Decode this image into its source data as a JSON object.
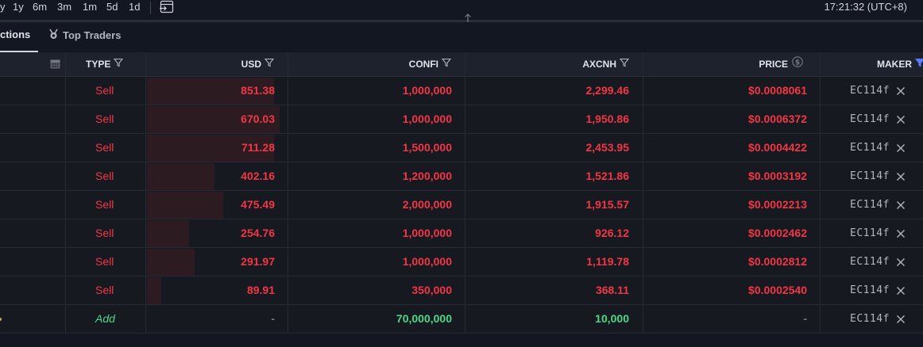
{
  "toolbar": {
    "timeframes": [
      "y",
      "1y",
      "6m",
      "3m",
      "1m",
      "5d",
      "1d"
    ],
    "clock": "17:21:32 (UTC+8)",
    "icons": [
      "goto-date-icon",
      "resize-handle-icon"
    ]
  },
  "tabs": {
    "active_label": "ctions",
    "second_label": "Top Traders",
    "second_icon": "medal-icon"
  },
  "table": {
    "headers": {
      "type": "TYPE",
      "usd": "USD",
      "confi": "CONFI",
      "axcnh": "AXCNH",
      "price": "PRICE",
      "maker": "MAKER"
    },
    "header_icons": [
      "calendar-icon",
      "filter-icon",
      "dollar-circle-icon",
      "filter-active-icon"
    ],
    "rows": [
      {
        "type": "Sell",
        "usd": "851.38",
        "confi": "1,000,000",
        "axcnh": "2,299.46",
        "price": "$0.0008061",
        "maker": "EC114f",
        "bar": 0.45
      },
      {
        "type": "Sell",
        "usd": "670.03",
        "confi": "1,000,000",
        "axcnh": "1,950.86",
        "price": "$0.0006372",
        "maker": "EC114f",
        "bar": 0.47
      },
      {
        "type": "Sell",
        "usd": "711.28",
        "confi": "1,500,000",
        "axcnh": "2,453.95",
        "price": "$0.0004422",
        "maker": "EC114f",
        "bar": 0.45
      },
      {
        "type": "Sell",
        "usd": "402.16",
        "confi": "1,200,000",
        "axcnh": "1,521.86",
        "price": "$0.0003192",
        "maker": "EC114f",
        "bar": 0.24
      },
      {
        "type": "Sell",
        "usd": "475.49",
        "confi": "2,000,000",
        "axcnh": "1,915.57",
        "price": "$0.0002213",
        "maker": "EC114f",
        "bar": 0.27
      },
      {
        "type": "Sell",
        "usd": "254.76",
        "confi": "1,000,000",
        "axcnh": "926.12",
        "price": "$0.0002462",
        "maker": "EC114f",
        "bar": 0.15
      },
      {
        "type": "Sell",
        "usd": "291.97",
        "confi": "1,000,000",
        "axcnh": "1,119.78",
        "price": "$0.0002812",
        "maker": "EC114f",
        "bar": 0.17
      },
      {
        "type": "Sell",
        "usd": "89.91",
        "confi": "350,000",
        "axcnh": "368.11",
        "price": "$0.0002540",
        "maker": "EC114f",
        "bar": 0.05
      },
      {
        "type": "Add",
        "usd": "-",
        "confi": "70,000,000",
        "axcnh": "10,000",
        "price": "-",
        "maker": "EC114f",
        "bar": 0
      }
    ]
  },
  "colors": {
    "sell": "#f23645",
    "add": "#4ed88a",
    "background": "#131722",
    "header_bg": "#1e222d",
    "accent_filter": "#5b7cfa"
  }
}
